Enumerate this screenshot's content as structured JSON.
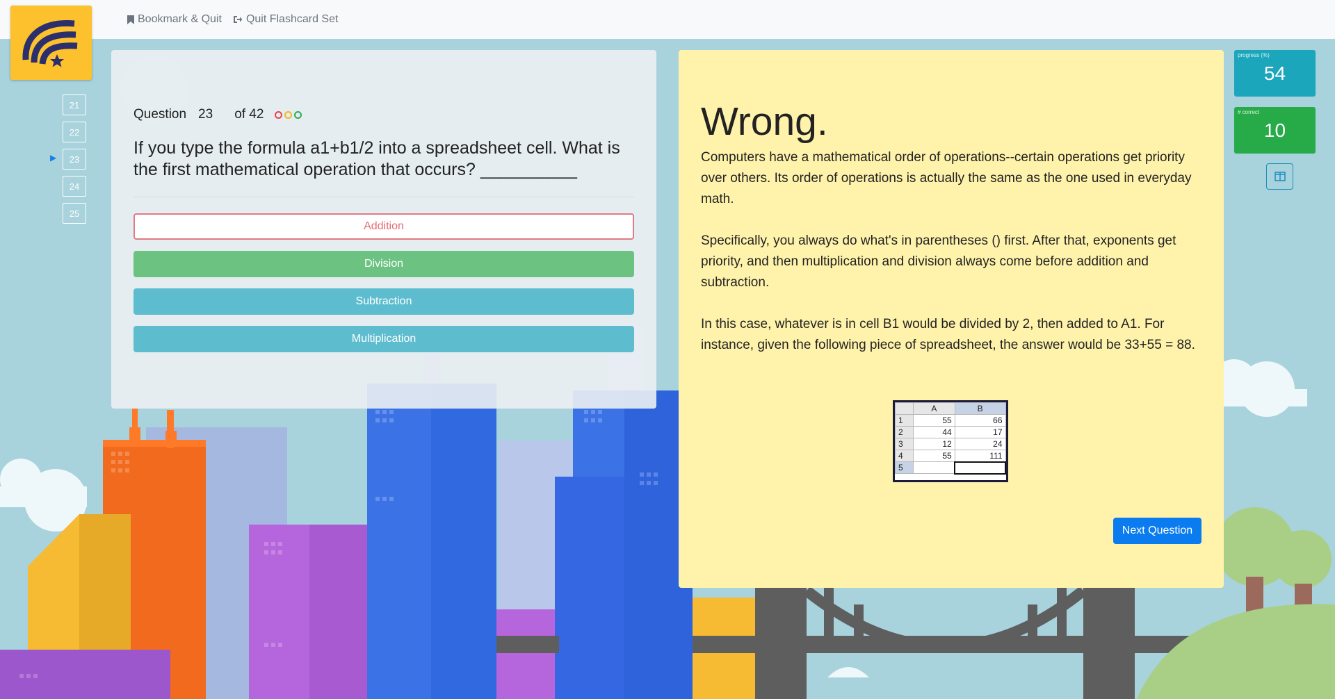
{
  "nav": {
    "bookmark_label": "Bookmark & Quit",
    "quit_label": "Quit Flashcard Set"
  },
  "question_list": [
    "21",
    "22",
    "23",
    "24",
    "25"
  ],
  "question": {
    "label": "Question",
    "current": "23",
    "of": "of 42",
    "dot_colors": [
      "#e8434d",
      "#f0b81f",
      "#2dac52"
    ],
    "text": "If you type the formula a1+b1/2 into a spreadsheet cell. What is the first mathematical operation that occurs? __________",
    "answers": [
      {
        "label": "Addition",
        "state": "wrong"
      },
      {
        "label": "Division",
        "state": "correct"
      },
      {
        "label": "Subtraction",
        "state": "other"
      },
      {
        "label": "Multiplication",
        "state": "other"
      }
    ]
  },
  "feedback": {
    "title": "Wrong.",
    "paragraphs": [
      "Computers have a mathematical order of operations--certain operations get priority over others. Its order of operations is actually the same as the one used in everyday math.",
      "Specifically, you always do what's in parentheses () first. After that, exponents get priority, and then multiplication and division always come before addition and subtraction.",
      "In this case, whatever is in cell B1 would be divided by 2, then added to A1. For instance, given the following piece of spreadsheet, the answer would be 33+55 = 88."
    ],
    "sheet": {
      "columns": [
        "A",
        "B"
      ],
      "rows": [
        {
          "n": "1",
          "a": "55",
          "b": "66"
        },
        {
          "n": "2",
          "a": "44",
          "b": "17"
        },
        {
          "n": "3",
          "a": "12",
          "b": "24"
        },
        {
          "n": "4",
          "a": "55",
          "b": "111"
        },
        {
          "n": "5",
          "a": "",
          "b": ""
        }
      ]
    },
    "next_label": "Next Question"
  },
  "stats": {
    "progress_label": "progress (%)",
    "progress_value": "54",
    "correct_label": "# correct",
    "correct_value": "10"
  },
  "colors": {
    "logo_bg": "#fcc12d",
    "progress_bg": "#1ba6bb",
    "correct_bg": "#27aa48",
    "next_bg": "#0a7cf0",
    "feedback_bg": "#fff3ab"
  }
}
